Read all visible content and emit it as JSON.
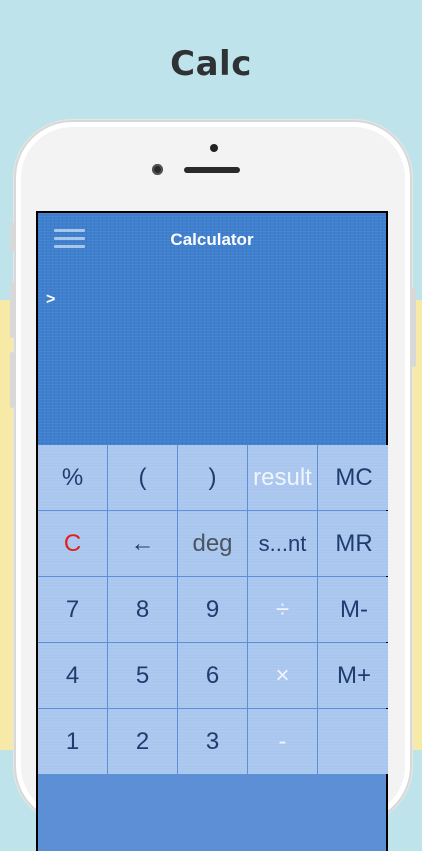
{
  "header": {
    "title": "Calc"
  },
  "app": {
    "title": "Calculator",
    "prompt": ">"
  },
  "keypad": {
    "rows": [
      [
        "%",
        "(",
        ")",
        "result",
        "MC"
      ],
      [
        "C",
        "←",
        "deg",
        "s...nt",
        "MR"
      ],
      [
        "7",
        "8",
        "9",
        "÷",
        "M-"
      ],
      [
        "4",
        "5",
        "6",
        "×",
        "M+"
      ],
      [
        "1",
        "2",
        "3",
        "-",
        ""
      ]
    ]
  },
  "colors": {
    "display": "#3f7fcf",
    "key": "#a9c6ee",
    "key_text": "#1d3d6e",
    "clear_text": "#e0201c",
    "top_background": "#bfe3ea",
    "bottom_background": "#f6eaa6"
  }
}
